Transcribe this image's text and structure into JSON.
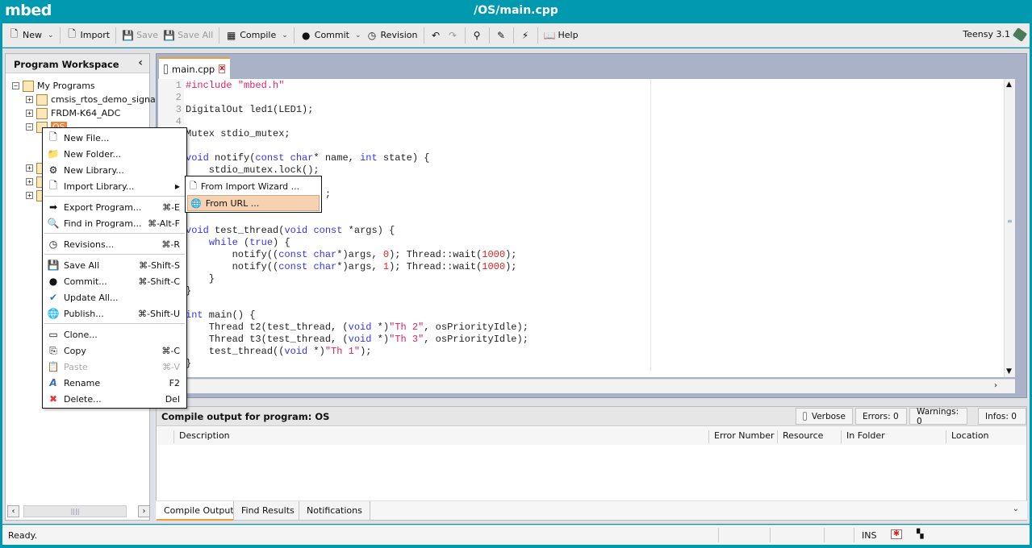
{
  "app": {
    "logo": "mbed",
    "title": "/OS/main.cpp"
  },
  "toolbar": {
    "items": [
      {
        "label": "New",
        "icon": "new-file-icon",
        "glyph": "🗋",
        "caret": true
      },
      {
        "sep": true
      },
      {
        "label": "Import",
        "icon": "import-icon",
        "glyph": "🗋"
      },
      {
        "sep": true
      },
      {
        "label": "Save",
        "icon": "save-icon",
        "glyph": "💾",
        "disabled": true
      },
      {
        "label": "Save All",
        "icon": "save-all-icon",
        "glyph": "💾",
        "disabled": true
      },
      {
        "sep": true
      },
      {
        "label": "Compile",
        "icon": "compile-icon",
        "glyph": "▦",
        "caret": true
      },
      {
        "sep": true
      },
      {
        "label": "Commit",
        "icon": "commit-icon",
        "glyph": "●",
        "caret": true
      },
      {
        "label": "Revision",
        "icon": "revision-icon",
        "glyph": "◷"
      },
      {
        "sep": true
      },
      {
        "label": "",
        "icon": "undo-icon",
        "glyph": "↶"
      },
      {
        "label": "",
        "icon": "redo-icon",
        "glyph": "↷",
        "disabled": true
      },
      {
        "sep": true
      },
      {
        "label": "",
        "icon": "binoculars-icon",
        "glyph": "⚲"
      },
      {
        "sep": true
      },
      {
        "label": "",
        "icon": "format-icon",
        "glyph": "✎"
      },
      {
        "sep": true
      },
      {
        "label": "",
        "icon": "wand-icon",
        "glyph": "⚡"
      },
      {
        "sep": true
      },
      {
        "label": "Help",
        "icon": "help-book-icon",
        "glyph": "📖"
      }
    ],
    "board": "Teensy 3.1"
  },
  "sidebar": {
    "title": "Program Workspace",
    "root": "My Programs",
    "programs": [
      "cmsis_rtos_demo_signal",
      "FRDM-K64_ADC",
      "OS"
    ]
  },
  "editor": {
    "tab": "main.cpp",
    "lines": [
      [
        [
          "#include ",
          "pp"
        ],
        [
          "\"mbed.h\"",
          "str"
        ]
      ],
      [],
      [
        [
          "DigitalOut led1(LED1);",
          ""
        ]
      ],
      [],
      [
        [
          "Mutex stdio_mutex;",
          ""
        ]
      ],
      [],
      [
        [
          "void",
          "kw"
        ],
        [
          " notify(",
          ""
        ],
        [
          "const",
          "kw"
        ],
        [
          " ",
          ""
        ],
        [
          "char",
          "kw"
        ],
        [
          "* name, ",
          ""
        ],
        [
          "int",
          "kw"
        ],
        [
          " state) {",
          ""
        ]
      ],
      [
        [
          "    stdio_mutex.lock();",
          ""
        ]
      ],
      [],
      [
        [
          "                        ;",
          ""
        ]
      ],
      [],
      [],
      [
        [
          "void",
          "kw"
        ],
        [
          " test_thread(",
          ""
        ],
        [
          "void",
          "kw"
        ],
        [
          " ",
          ""
        ],
        [
          "const",
          "kw"
        ],
        [
          " *args) {",
          ""
        ]
      ],
      [
        [
          "    ",
          ""
        ],
        [
          "while",
          "kw"
        ],
        [
          " (",
          ""
        ],
        [
          "true",
          "kw"
        ],
        [
          ") {",
          ""
        ]
      ],
      [
        [
          "        notify((",
          ""
        ],
        [
          "const",
          "kw"
        ],
        [
          " ",
          ""
        ],
        [
          "char",
          "kw"
        ],
        [
          "*)args, ",
          ""
        ],
        [
          "0",
          "num"
        ],
        [
          "); Thread::wait(",
          ""
        ],
        [
          "1000",
          "num"
        ],
        [
          ");",
          ""
        ]
      ],
      [
        [
          "        notify((",
          ""
        ],
        [
          "const",
          "kw"
        ],
        [
          " ",
          ""
        ],
        [
          "char",
          "kw"
        ],
        [
          "*)args, ",
          ""
        ],
        [
          "1",
          "num"
        ],
        [
          "); Thread::wait(",
          ""
        ],
        [
          "1000",
          "num"
        ],
        [
          ");",
          ""
        ]
      ],
      [
        [
          "    }",
          ""
        ]
      ],
      [
        [
          "}",
          ""
        ]
      ],
      [],
      [
        [
          "int",
          "kw"
        ],
        [
          " main() {",
          ""
        ]
      ],
      [
        [
          "    Thread t2(test_thread, (",
          ""
        ],
        [
          "void",
          "kw"
        ],
        [
          " *)",
          ""
        ],
        [
          "\"Th 2\"",
          "str"
        ],
        [
          ", osPriorityIdle);",
          ""
        ]
      ],
      [
        [
          "    Thread t3(test_thread, (",
          ""
        ],
        [
          "void",
          "kw"
        ],
        [
          " *)",
          ""
        ],
        [
          "\"Th 3\"",
          "str"
        ],
        [
          ", osPriorityIdle);",
          ""
        ]
      ],
      [
        [
          "    test_thread((",
          ""
        ],
        [
          "void",
          "kw"
        ],
        [
          " *)",
          ""
        ],
        [
          "\"Th 1\"",
          "str"
        ],
        [
          ");",
          ""
        ]
      ],
      [
        [
          "}",
          ""
        ]
      ]
    ],
    "visible_line_numbers": [
      "1",
      "2",
      "3",
      "4"
    ]
  },
  "context_menu": {
    "groups": [
      [
        {
          "label": "New File...",
          "icon": "new-file-icon",
          "glyph": "🗋"
        },
        {
          "label": "New Folder...",
          "icon": "new-folder-icon",
          "glyph": "📁"
        },
        {
          "label": "New Library...",
          "icon": "new-library-icon",
          "glyph": "⚙"
        },
        {
          "label": "Import Library...",
          "icon": "import-library-icon",
          "glyph": "🗋",
          "submenu": true
        }
      ],
      [
        {
          "label": "Export Program...",
          "icon": "export-icon",
          "glyph": "➡",
          "shortcut": "⌘-E"
        },
        {
          "label": "Find in Program...",
          "icon": "find-icon",
          "glyph": "🔍",
          "shortcut": "⌘-Alt-F"
        }
      ],
      [
        {
          "label": "Revisions...",
          "icon": "revisions-icon",
          "glyph": "◷",
          "shortcut": "⌘-R"
        }
      ],
      [
        {
          "label": "Save All",
          "icon": "save-all-icon",
          "glyph": "💾",
          "shortcut": "⌘-Shift-S"
        },
        {
          "label": "Commit...",
          "icon": "commit-icon",
          "glyph": "●",
          "shortcut": "⌘-Shift-C"
        },
        {
          "label": "Update All...",
          "icon": "checkmark-icon",
          "glyph": "✔"
        },
        {
          "label": "Publish...",
          "icon": "globe-icon",
          "glyph": "🌐",
          "shortcut": "⌘-Shift-U"
        }
      ],
      [
        {
          "label": "Clone...",
          "icon": "clone-icon",
          "glyph": "▭"
        },
        {
          "label": "Copy",
          "icon": "copy-icon",
          "glyph": "⎘",
          "shortcut": "⌘-C"
        },
        {
          "label": "Paste",
          "icon": "paste-icon",
          "glyph": "📋",
          "shortcut": "⌘-V",
          "disabled": true
        },
        {
          "label": "Rename",
          "icon": "rename-icon",
          "glyph": "A"
        },
        {
          "label": "Delete...",
          "icon": "delete-icon",
          "glyph": "✖",
          "shortcut": "Del"
        }
      ]
    ],
    "rename_shortcut": "F2",
    "submenu": [
      {
        "label": "From Import Wizard ...",
        "icon": "import-wizard-icon",
        "glyph": "🗋"
      },
      {
        "label": "From URL ...",
        "icon": "globe-icon",
        "glyph": "🌐",
        "highlighted": true
      }
    ]
  },
  "output": {
    "title": "Compile output for program: OS",
    "verbose": "Verbose",
    "errors": "Errors: 0",
    "warnings": "Warnings: 0",
    "infos": "Infos: 0",
    "columns": [
      "Description",
      "Error Number",
      "Resource",
      "In Folder",
      "Location"
    ],
    "tabs": [
      "Compile Output",
      "Find Results",
      "Notifications"
    ]
  },
  "status": {
    "text": "Ready.",
    "mode": "INS"
  },
  "colors": {
    "brand": "#0099b0",
    "accent": "#f39a3a",
    "selection": "#f0823a",
    "keyword": "#3333ee",
    "string": "#e0206a"
  }
}
